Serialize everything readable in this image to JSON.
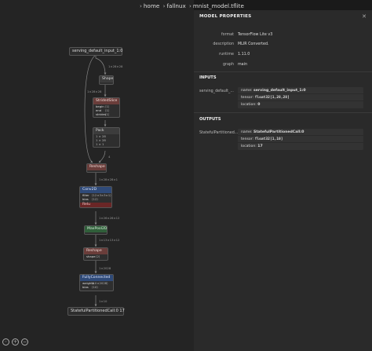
{
  "breadcrumb": {
    "items": [
      "home",
      "fallnux",
      "mnist_model.tflite"
    ]
  },
  "graph": {
    "nodes": {
      "input": "serving_default_input_1:0",
      "shape": "Shape",
      "strided": {
        "title": "StridedSlice",
        "attrs": [
          [
            "begin",
            "⟨1⟩"
          ],
          [
            "end",
            "⟨1⟩"
          ],
          [
            "strides",
            "⟨1⟩"
          ]
        ]
      },
      "pack": {
        "title": "Pack",
        "attrs": [
          [
            "1 × 28",
            ""
          ],
          [
            "1 × 28",
            ""
          ],
          [
            "1 × 1",
            ""
          ]
        ]
      },
      "reshape1": "Reshape",
      "conv": {
        "title": "Conv2D",
        "attrs": [
          [
            "filter",
            "⟨12×3×3×1⟩"
          ],
          [
            "bias",
            "⟨12⟩"
          ]
        ],
        "act": "Relu"
      },
      "maxpool": "MaxPool2D",
      "reshape2": {
        "title": "Reshape",
        "attrs": [
          [
            "shape",
            "⟨2⟩"
          ]
        ]
      },
      "fc": {
        "title": "FullyConnected",
        "attrs": [
          [
            "weights",
            "⟨10×2028⟩"
          ],
          [
            "bias",
            "⟨10⟩"
          ]
        ]
      },
      "output": "StatefulPartitionedCall:0 17"
    },
    "edges": {
      "e1": "1×28×28",
      "e2": "1×28×28",
      "e3": "1×28×28×1",
      "e4": "1×26×26×12",
      "e5": "1×13×13×12",
      "e6": "1×2028",
      "e7": "1×10",
      "e8": "4"
    }
  },
  "toolbar": {
    "icons": [
      "zoom-fit-icon",
      "zoom-in-icon",
      "zoom-out-icon"
    ]
  },
  "panel": {
    "title": "MODEL PROPERTIES",
    "close": "✕",
    "properties": [
      {
        "key": "format",
        "value": "TensorFlow Lite v3"
      },
      {
        "key": "description",
        "value": "MLIR Converted."
      },
      {
        "key": "runtime",
        "value": "1.11.0"
      },
      {
        "key": "graph",
        "value": "main"
      }
    ],
    "inputs_title": "INPUTS",
    "input": {
      "key": "serving_default_...",
      "name_label": "name:",
      "name": "serving_default_input_1:0",
      "tensor_label": "tensor:",
      "tensor": "float32[1,28,28]",
      "location_label": "location:",
      "location": "0"
    },
    "outputs_title": "OUTPUTS",
    "output": {
      "key": "StatefulPartitioned...",
      "name_label": "name:",
      "name": "StatefulPartitionedCall:0",
      "tensor_label": "tensor:",
      "tensor": "float32[1,10]",
      "location_label": "location:",
      "location": "17"
    }
  }
}
